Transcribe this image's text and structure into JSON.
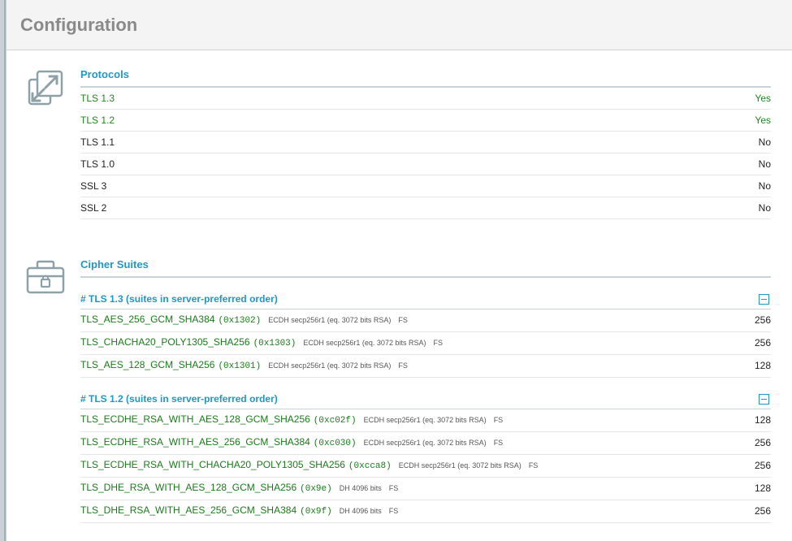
{
  "page": {
    "title": "Configuration"
  },
  "protocols": {
    "title": "Protocols",
    "rows": [
      {
        "name": "TLS 1.3",
        "value": "Yes",
        "supported": true
      },
      {
        "name": "TLS 1.2",
        "value": "Yes",
        "supported": true
      },
      {
        "name": "TLS 1.1",
        "value": "No",
        "supported": false
      },
      {
        "name": "TLS 1.0",
        "value": "No",
        "supported": false
      },
      {
        "name": "SSL 3",
        "value": "No",
        "supported": false
      },
      {
        "name": "SSL 2",
        "value": "No",
        "supported": false
      }
    ]
  },
  "ciphers": {
    "title": "Cipher Suites",
    "groups": [
      {
        "title": "# TLS 1.3 (suites in server-preferred order)",
        "suites": [
          {
            "name": "TLS_AES_256_GCM_SHA384",
            "code": "(0x1302)",
            "detail": "ECDH secp256r1 (eq. 3072 bits RSA)",
            "fs": "FS",
            "bits": "256"
          },
          {
            "name": "TLS_CHACHA20_POLY1305_SHA256",
            "code": "(0x1303)",
            "detail": "ECDH secp256r1 (eq. 3072 bits RSA)",
            "fs": "FS",
            "bits": "256"
          },
          {
            "name": "TLS_AES_128_GCM_SHA256",
            "code": "(0x1301)",
            "detail": "ECDH secp256r1 (eq. 3072 bits RSA)",
            "fs": "FS",
            "bits": "128"
          }
        ]
      },
      {
        "title": "# TLS 1.2 (suites in server-preferred order)",
        "suites": [
          {
            "name": "TLS_ECDHE_RSA_WITH_AES_128_GCM_SHA256",
            "code": "(0xc02f)",
            "detail": "ECDH secp256r1 (eq. 3072 bits RSA)",
            "fs": "FS",
            "bits": "128"
          },
          {
            "name": "TLS_ECDHE_RSA_WITH_AES_256_GCM_SHA384",
            "code": "(0xc030)",
            "detail": "ECDH secp256r1 (eq. 3072 bits RSA)",
            "fs": "FS",
            "bits": "256"
          },
          {
            "name": "TLS_ECDHE_RSA_WITH_CHACHA20_POLY1305_SHA256",
            "code": "(0xcca8)",
            "detail": "ECDH secp256r1 (eq. 3072 bits RSA)",
            "fs": "FS",
            "bits": "256"
          },
          {
            "name": "TLS_DHE_RSA_WITH_AES_128_GCM_SHA256",
            "code": "(0x9e)",
            "detail": "DH 4096 bits",
            "fs": "FS",
            "bits": "128"
          },
          {
            "name": "TLS_DHE_RSA_WITH_AES_256_GCM_SHA384",
            "code": "(0x9f)",
            "detail": "DH 4096 bits",
            "fs": "FS",
            "bits": "256"
          }
        ]
      }
    ]
  },
  "colors": {
    "accent": "#1f97c7",
    "supported": "#1a8a1a",
    "cipher_name": "#1a7a1a",
    "header_text": "#8a8a8a"
  },
  "icons": {
    "protocols": "expand-arrows-icon",
    "ciphers": "lockbox-icon",
    "collapse": "collapse-minus-icon"
  }
}
